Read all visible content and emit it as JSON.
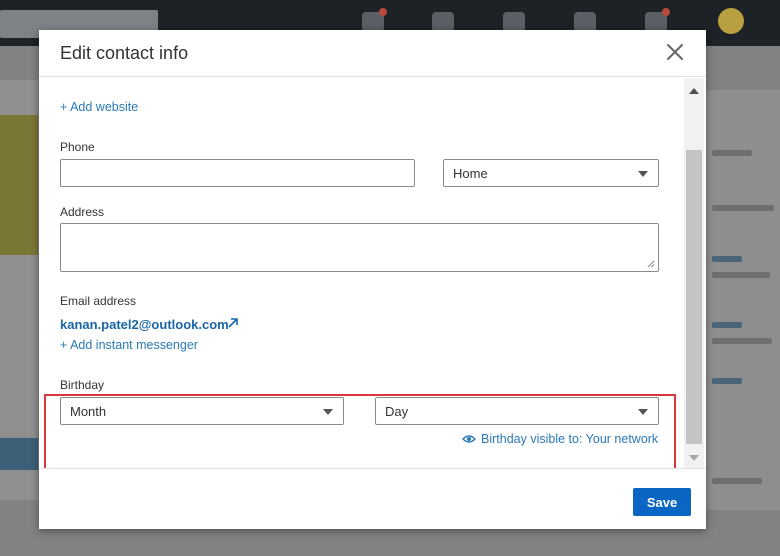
{
  "modal": {
    "title": "Edit contact info",
    "add_website_label": "+ Add website",
    "phone": {
      "label": "Phone",
      "value": "",
      "type_selected": "Home"
    },
    "address": {
      "label": "Address",
      "value": ""
    },
    "email": {
      "label": "Email address",
      "value": "kanan.patel2@outlook.com"
    },
    "add_messenger_label": "+ Add instant messenger",
    "birthday": {
      "label": "Birthday",
      "month_selected": "Month",
      "day_selected": "Day",
      "visibility_text": "Birthday visible to: Your network"
    },
    "save_label": "Save"
  },
  "colors": {
    "accent": "#0a66c2",
    "link": "#2a7ab8",
    "highlight": "#d9363e"
  },
  "icons": [
    "close-icon",
    "external-link-icon",
    "eye-icon",
    "chevron-down-icon"
  ]
}
